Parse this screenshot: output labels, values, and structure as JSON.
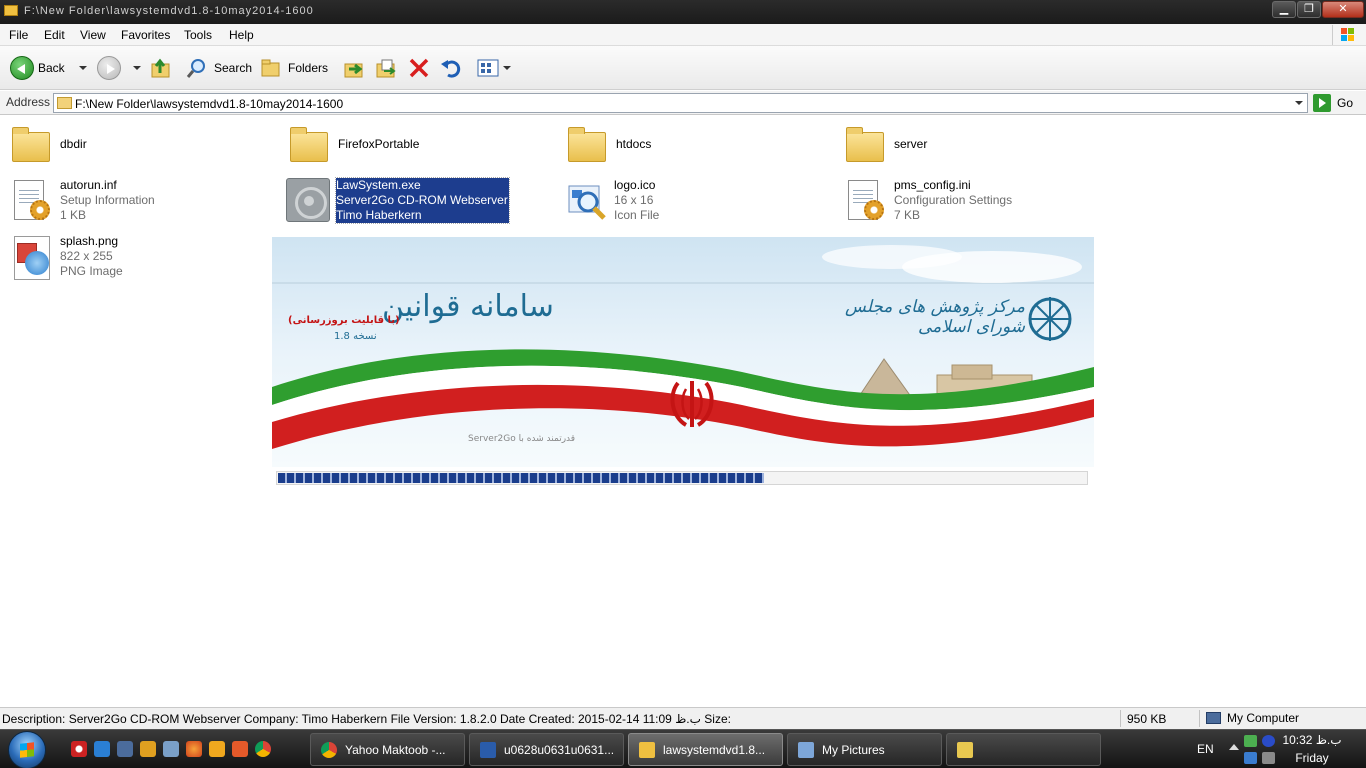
{
  "window": {
    "title": "F:\\New Folder\\lawsystemdvd1.8-10may2014-1600",
    "controls": {
      "minimize": "▁",
      "maximize": "❐",
      "close": "✕"
    }
  },
  "menu": [
    "File",
    "Edit",
    "View",
    "Favorites",
    "Tools",
    "Help"
  ],
  "toolbar": {
    "back_label": "Back",
    "search_label": "Search",
    "folders_label": "Folders"
  },
  "address": {
    "label": "Address",
    "value": "F:\\New Folder\\lawsystemdvd1.8-10may2014-1600",
    "go_label": "Go"
  },
  "files": [
    {
      "name": "dbdir",
      "type": "folder"
    },
    {
      "name": "FirefoxPortable",
      "type": "folder"
    },
    {
      "name": "htdocs",
      "type": "folder"
    },
    {
      "name": "server",
      "type": "folder"
    },
    {
      "name": "autorun.inf",
      "line2": "Setup Information",
      "line3": "1 KB",
      "type": "inf"
    },
    {
      "name": "LawSystem.exe",
      "line2": "Server2Go CD-ROM Webserver",
      "line3": "Timo Haberkern",
      "type": "exe",
      "selected": true
    },
    {
      "name": "logo.ico",
      "line2": "16 x 16",
      "line3": "Icon File",
      "type": "ico"
    },
    {
      "name": "pms_config.ini",
      "line2": "Configuration Settings",
      "line3": "7 KB",
      "type": "ini"
    },
    {
      "name": "splash.png",
      "line2": "822 x 255",
      "line3": "PNG Image",
      "type": "png"
    }
  ],
  "splash": {
    "title_fa": "سامانه قوانين",
    "capability_fa": "(با قابليت بروزرسانی)",
    "version_fa": "نسخه 1.8",
    "org_fa": "مرکز پژوهش های مجلس شورای اسلامی",
    "powered_fa": "قدرتمند شده با Server2Go",
    "progress": 0.6
  },
  "status": {
    "description": "Description: Server2Go CD-ROM Webserver Company: Timo Haberkern File Version: 1.8.2.0 Date Created: 2015-02-14 11:09 ب.ظ Size:",
    "size": "950 KB",
    "location": "My Computer"
  },
  "taskbar": {
    "tasks": [
      {
        "label": "Yahoo Maktoob -...",
        "icon_color": "#e5a631"
      },
      {
        "label": "u0628u0631u0631...",
        "icon_color": "#2a5caa"
      },
      {
        "label": "lawsystemdvd1.8...",
        "icon_color": "#f0c040",
        "active": true
      },
      {
        "label": "My Pictures",
        "icon_color": "#7da6d8"
      },
      {
        "label": "",
        "icon_color": "#e8c850"
      }
    ],
    "lang": "EN",
    "time": "10:32 ب.ظ",
    "day": "Friday"
  },
  "colors": {
    "selection": "#1d3d8e",
    "iran_green": "#2f9e2f",
    "iran_red": "#d11f1f",
    "splash_title": "#1f6c93"
  }
}
